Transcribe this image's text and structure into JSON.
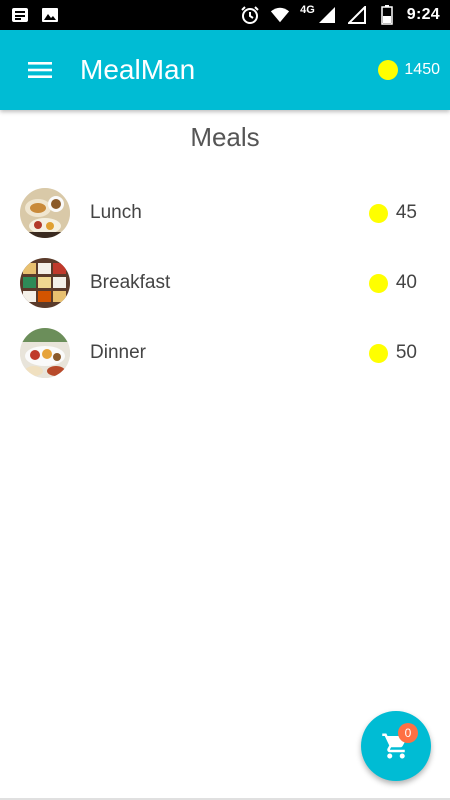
{
  "status_bar": {
    "time": "9:24",
    "network_label": "4G",
    "icons": [
      "notification-icon",
      "image-icon",
      "alarm-icon",
      "wifi-icon",
      "signal-icon",
      "signal-icon",
      "battery-icon"
    ]
  },
  "app_bar": {
    "title": "MealMan",
    "balance": "1450",
    "coin_color": "#ffff00",
    "accent_color": "#00bcd4"
  },
  "page": {
    "title": "Meals"
  },
  "meals": [
    {
      "name": "Lunch",
      "price": "45"
    },
    {
      "name": "Breakfast",
      "price": "40"
    },
    {
      "name": "Dinner",
      "price": "50"
    }
  ],
  "cart": {
    "count": "0",
    "badge_color": "#ff7043"
  }
}
